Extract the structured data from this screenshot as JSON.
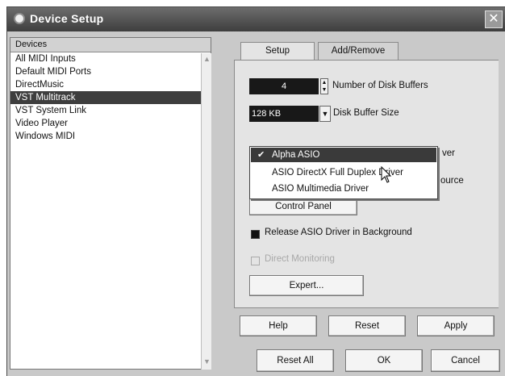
{
  "window": {
    "title": "Device Setup",
    "close_glyph": "✕"
  },
  "devices": {
    "header": "Devices",
    "items": [
      "All MIDI Inputs",
      "Default MIDI Ports",
      "DirectMusic",
      "VST Multitrack",
      "VST System Link",
      "Video Player",
      "Windows MIDI"
    ],
    "selected_index": 3
  },
  "tabs": [
    {
      "label": "Setup",
      "active": true
    },
    {
      "label": "Add/Remove",
      "active": false
    }
  ],
  "setup": {
    "disk_buffers_value": "4",
    "disk_buffers_label": "Number of Disk Buffers",
    "buffer_size_value": "128 KB",
    "buffer_size_label": "Disk Buffer Size",
    "driver_label_tail": "ver",
    "clock_label_tail": "ource",
    "control_panel_label": "Control Panel",
    "release_asio_label": "Release ASIO Driver in Background",
    "release_asio_checked": true,
    "direct_monitoring_label": "Direct Monitoring",
    "direct_monitoring_checked": false,
    "expert_label": "Expert..."
  },
  "driver_dropdown": {
    "options": [
      "Alpha ASIO",
      "ASIO DirectX Full Duplex Driver",
      "ASIO Multimedia Driver"
    ],
    "selected_index": 0,
    "check_glyph": "✔"
  },
  "buttons": {
    "help": "Help",
    "reset": "Reset",
    "apply": "Apply",
    "reset_all": "Reset All",
    "ok": "OK",
    "cancel": "Cancel"
  },
  "colors": {
    "titlebar": "#4a4a4a",
    "selection": "#3e3e3e",
    "field": "#181818"
  }
}
